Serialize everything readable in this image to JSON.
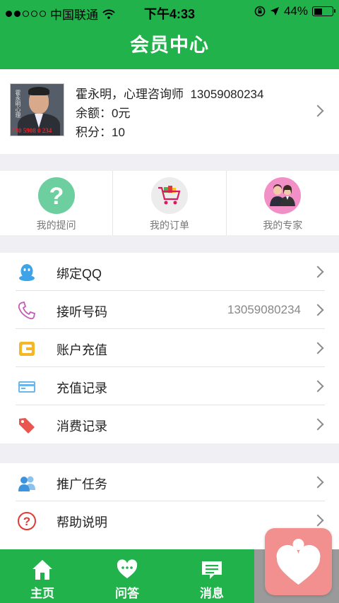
{
  "status_bar": {
    "carrier": "中国联通",
    "time": "下午4:33",
    "battery": "44%",
    "battery_level": 0.44,
    "signal_bars": 2
  },
  "header": {
    "title": "会员中心"
  },
  "profile": {
    "name_line": "霍永明，心理咨询师",
    "phone": "13059080234",
    "balance": "余额：0元",
    "points": "积分：10",
    "avatar_stamp": "130 5908 0 234",
    "avatar_calligraphy": "霍永明心理"
  },
  "quick_actions": [
    {
      "label": "我的提问",
      "icon": "question-icon",
      "color": "#6dcf9f"
    },
    {
      "label": "我的订单",
      "icon": "shopping-cart-icon",
      "color": "#ececec"
    },
    {
      "label": "我的专家",
      "icon": "experts-icon",
      "color": "#f28fc7"
    }
  ],
  "menu_group_1": [
    {
      "label": "绑定QQ",
      "icon": "qq-icon",
      "value": ""
    },
    {
      "label": "接听号码",
      "icon": "phone-icon",
      "value": "13059080234"
    },
    {
      "label": "账户充值",
      "icon": "wallet-icon",
      "value": ""
    },
    {
      "label": "充值记录",
      "icon": "card-icon",
      "value": ""
    },
    {
      "label": "消费记录",
      "icon": "price-tag-icon",
      "value": ""
    }
  ],
  "menu_group_2": [
    {
      "label": "推广任务",
      "icon": "users-icon",
      "value": ""
    },
    {
      "label": "帮助说明",
      "icon": "help-icon",
      "value": ""
    }
  ],
  "tabbar": [
    {
      "label": "主页",
      "icon": "home-icon"
    },
    {
      "label": "问答",
      "icon": "qa-icon"
    },
    {
      "label": "消息",
      "icon": "message-icon"
    },
    {
      "label": "",
      "icon": "profile-tab-icon"
    }
  ],
  "floating_button": {
    "icon": "heart-person-icon"
  },
  "colors": {
    "brand_green": "#21b24b",
    "background": "#efeff4"
  }
}
